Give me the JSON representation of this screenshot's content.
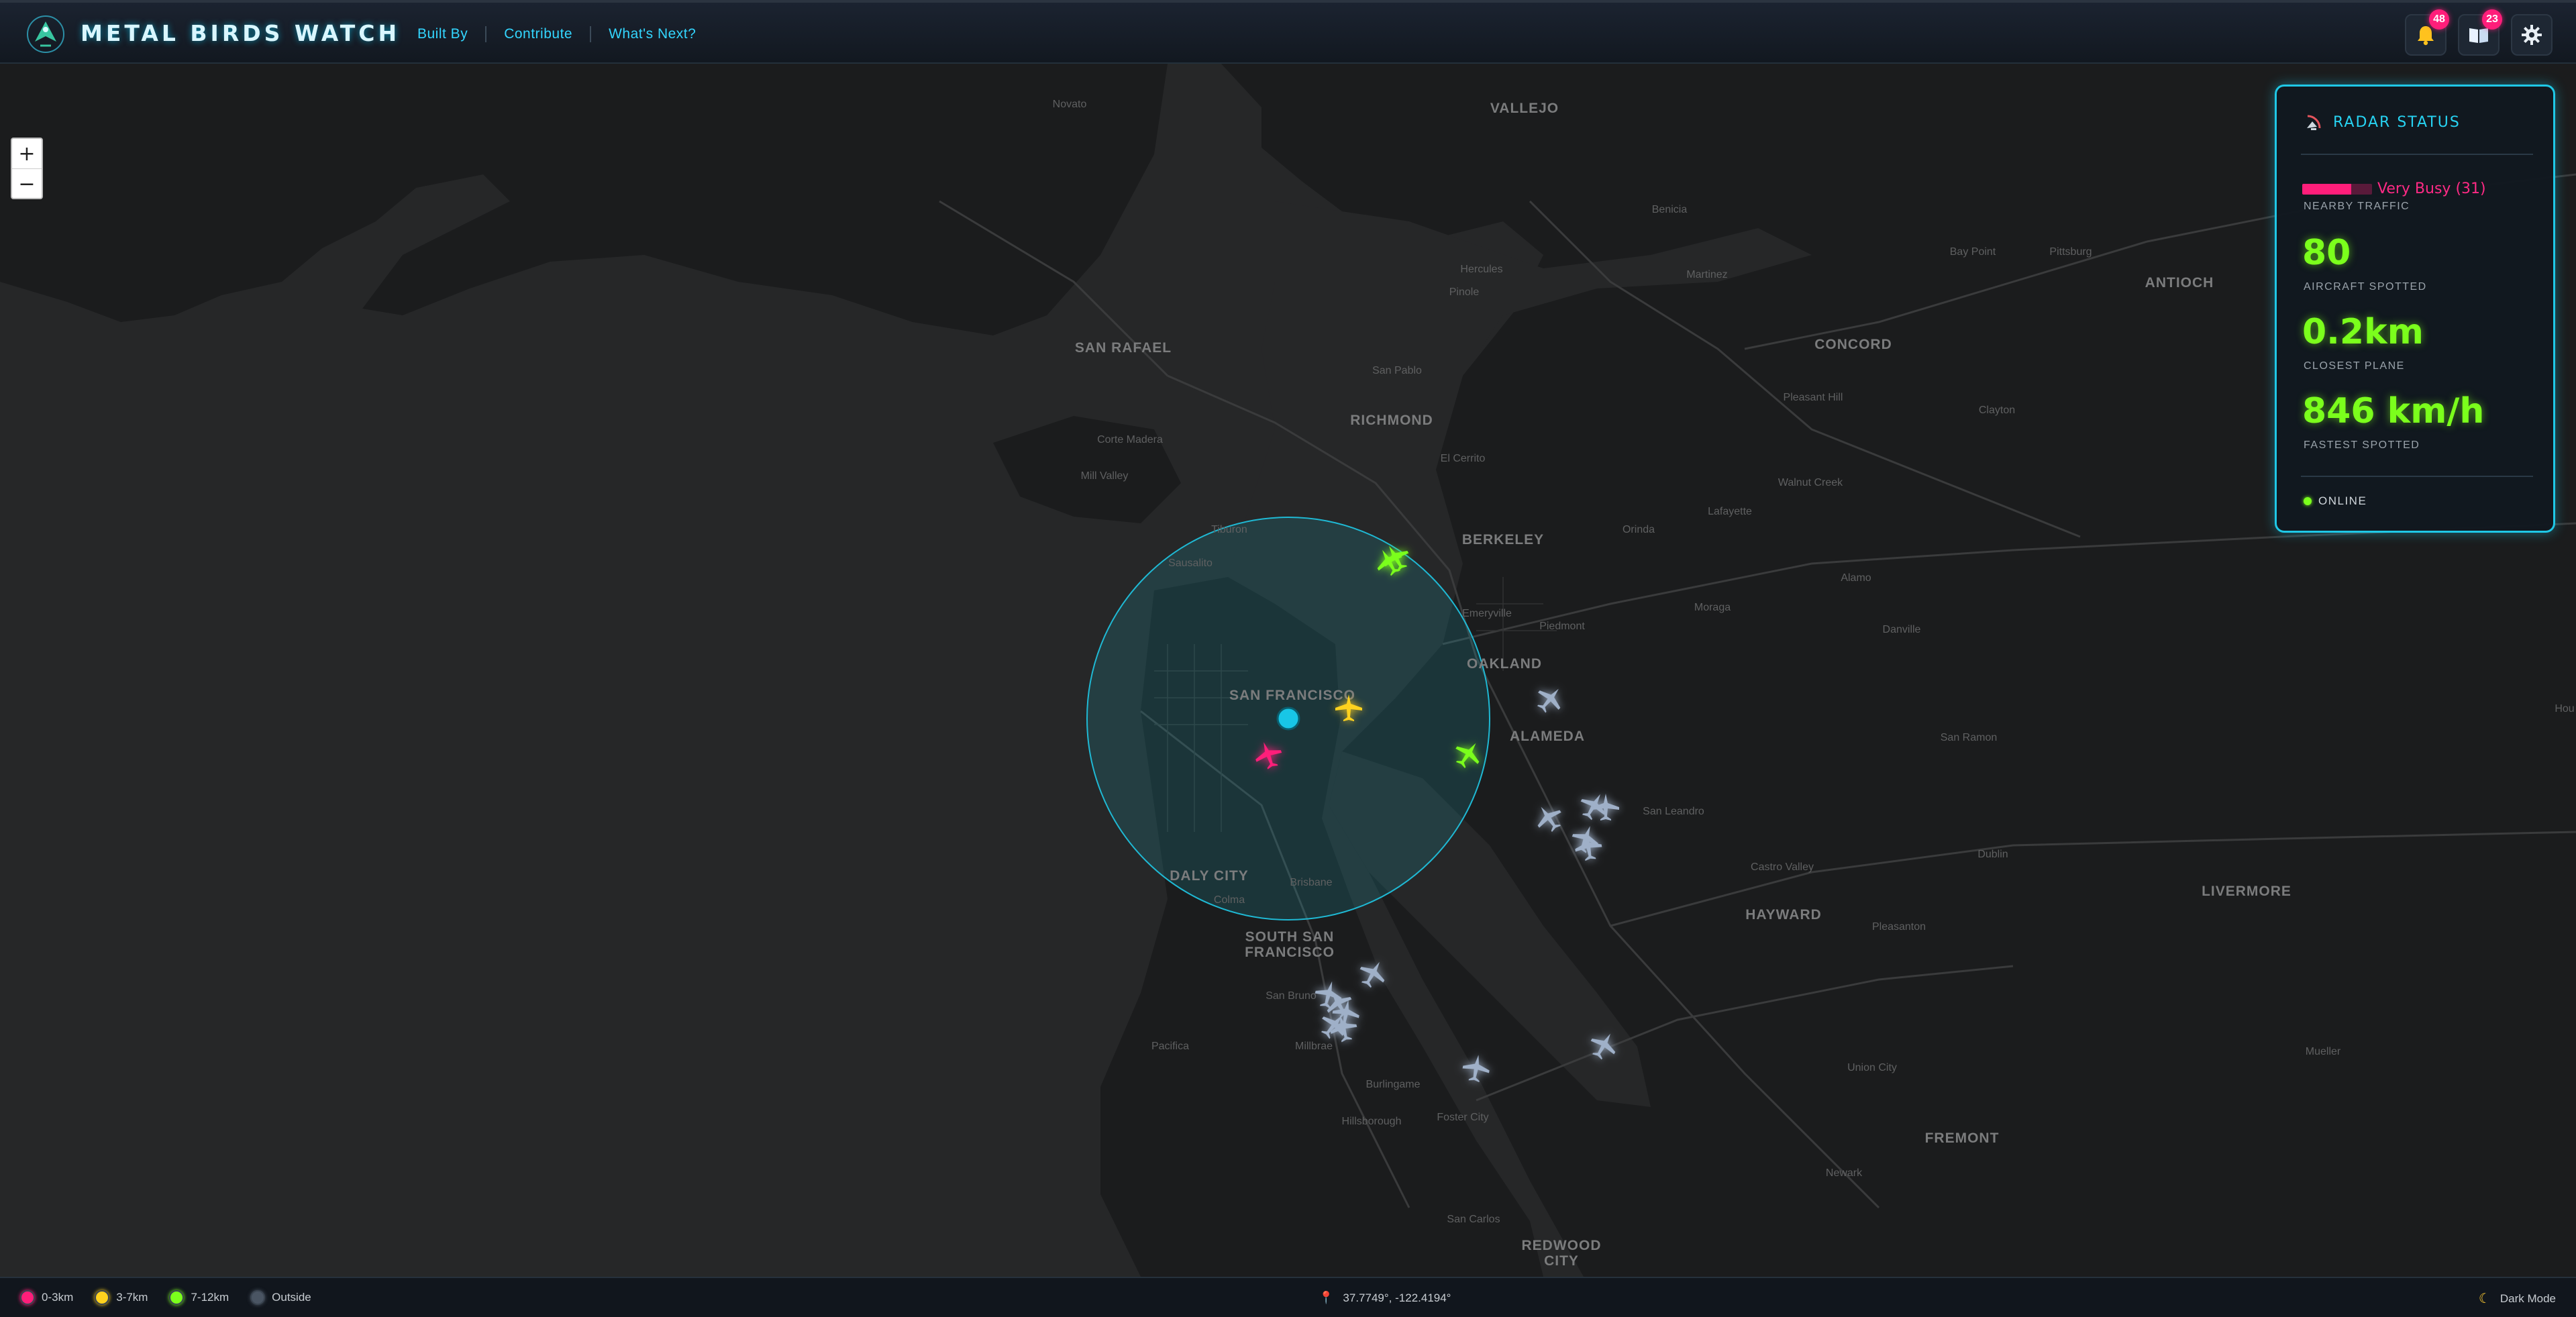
{
  "header": {
    "brand": "METAL BIRDS WATCH",
    "nav": [
      "Built By",
      "Contribute",
      "What's Next?"
    ],
    "notifications_count": "48",
    "log_count": "23"
  },
  "map": {
    "places": [
      {
        "name": "Novato",
        "size": "small"
      },
      {
        "name": "VALLEJO",
        "size": "big"
      },
      {
        "name": "Benicia",
        "size": "small"
      },
      {
        "name": "Martinez",
        "size": "small"
      },
      {
        "name": "Bay Point",
        "size": "small"
      },
      {
        "name": "Pittsburg",
        "size": "small"
      },
      {
        "name": "ANTIOCH",
        "size": "big"
      },
      {
        "name": "Hercules",
        "size": "small"
      },
      {
        "name": "Pinole",
        "size": "small"
      },
      {
        "name": "SAN RAFAEL",
        "size": "big"
      },
      {
        "name": "San Pablo",
        "size": "small"
      },
      {
        "name": "CONCORD",
        "size": "big"
      },
      {
        "name": "Pleasant Hill",
        "size": "small"
      },
      {
        "name": "Clayton",
        "size": "small"
      },
      {
        "name": "Corte Madera",
        "size": "small"
      },
      {
        "name": "RICHMOND",
        "size": "big"
      },
      {
        "name": "El Cerrito",
        "size": "small"
      },
      {
        "name": "Mill Valley",
        "size": "small"
      },
      {
        "name": "Walnut Creek",
        "size": "small"
      },
      {
        "name": "Lafayette",
        "size": "small"
      },
      {
        "name": "Orinda",
        "size": "small"
      },
      {
        "name": "BERKELEY",
        "size": "big"
      },
      {
        "name": "Tiburon",
        "size": "small"
      },
      {
        "name": "Sausalito",
        "size": "small"
      },
      {
        "name": "Emeryville",
        "size": "small"
      },
      {
        "name": "Alamo",
        "size": "small"
      },
      {
        "name": "Piedmont",
        "size": "small"
      },
      {
        "name": "Moraga",
        "size": "small"
      },
      {
        "name": "Danville",
        "size": "small"
      },
      {
        "name": "OAKLAND",
        "size": "big"
      },
      {
        "name": "SAN FRANCISCO",
        "size": "big"
      },
      {
        "name": "ALAMEDA",
        "size": "big"
      },
      {
        "name": "San Ramon",
        "size": "small"
      },
      {
        "name": "San Leandro",
        "size": "small"
      },
      {
        "name": "Dublin",
        "size": "small"
      },
      {
        "name": "Castro Valley",
        "size": "small"
      },
      {
        "name": "DALY CITY",
        "size": "big"
      },
      {
        "name": "Brisbane",
        "size": "small"
      },
      {
        "name": "Colma",
        "size": "small"
      },
      {
        "name": "HAYWARD",
        "size": "big"
      },
      {
        "name": "LIVERMORE",
        "size": "big"
      },
      {
        "name": "SOUTH SAN",
        "size": "big"
      },
      {
        "name": "FRANCISCO",
        "size": "big"
      },
      {
        "name": "Pleasanton",
        "size": "small"
      },
      {
        "name": "San Bruno",
        "size": "small"
      },
      {
        "name": "Pacifica",
        "size": "small"
      },
      {
        "name": "Millbrae",
        "size": "small"
      },
      {
        "name": "Union City",
        "size": "small"
      },
      {
        "name": "Burlingame",
        "size": "small"
      },
      {
        "name": "FREMONT",
        "size": "big"
      },
      {
        "name": "Hillsborough",
        "size": "small"
      },
      {
        "name": "Foster City",
        "size": "small"
      },
      {
        "name": "Newark",
        "size": "small"
      },
      {
        "name": "San Carlos",
        "size": "small"
      },
      {
        "name": "REDWOOD",
        "size": "big"
      },
      {
        "name": "CITY",
        "size": "big"
      },
      {
        "name": "Mueller",
        "size": "small"
      },
      {
        "name": "Hou",
        "size": "small"
      }
    ]
  },
  "zoom": {
    "in": "+",
    "out": "−"
  },
  "radar": {
    "title": "RADAR STATUS",
    "traffic_level": 0.7,
    "traffic_text": "Very Busy (31)",
    "traffic_label": "NEARBY TRAFFIC",
    "aircraft": "80",
    "aircraft_label": "AIRCRAFT SPOTTED",
    "closest": "0.2km",
    "closest_label": "CLOSEST PLANE",
    "fastest": "846 km/h",
    "fastest_label": "FASTEST SPOTTED",
    "status": "ONLINE"
  },
  "footer": {
    "legend": [
      {
        "label": "0-3km",
        "color": "#ff1e7a"
      },
      {
        "label": "3-7km",
        "color": "#ffd21e"
      },
      {
        "label": "7-12km",
        "color": "#7bff1c"
      },
      {
        "label": "Outside",
        "color": "#4a5563"
      }
    ],
    "coords": "37.7749°, -122.4194°",
    "mode": "Dark Mode"
  },
  "colors": {
    "accent": "#1fc8e6",
    "near": "#ff1e7a",
    "mid": "#ffd21e",
    "far": "#7bff1c",
    "outside": "#9fb0c8"
  }
}
